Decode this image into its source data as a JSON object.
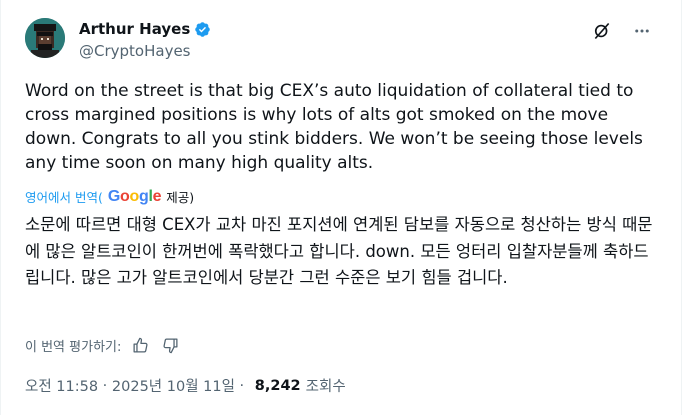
{
  "author": {
    "display_name": "Arthur Hayes",
    "handle": "@CryptoHayes",
    "verified_color": "#1d9bf0"
  },
  "tweet": {
    "text": "Word on the street is that big CEX’s auto liquidation of collateral tied to cross margined positions is why lots of alts got smoked on the move down. Congrats to all you stink bidders. We won’t be seeing those levels any time soon on many high quality alts."
  },
  "translation": {
    "label_prefix": "영어에서 번역(",
    "provider": "Google",
    "label_suffix": "제공)",
    "text": "소문에 따르면 대형 CEX가 교차 마진 포지션에 연계된 담보를 자동으로 청산하는 방식 때문에 많은 알트코인이 한꺼번에 폭락했다고 합니다. down. 모든 엉터리 입찰자분들께 축하드립니다. 많은 고가 알트코인에서 당분간 그런 수준은 보기 힘들 겁니다.",
    "rate_label": "이 번역 평가하기:"
  },
  "meta": {
    "time": "오전 11:58",
    "sep1": " · ",
    "date": "2025년 10월 11일",
    "sep2": " · ",
    "views": "8,242",
    "views_label": "조회수"
  },
  "icons": {
    "grok": "grok-icon",
    "more": "more-icon",
    "thumbs_up": "thumbs-up-icon",
    "thumbs_down": "thumbs-down-icon"
  },
  "colors": {
    "text": "#0f1419",
    "secondary": "#536471",
    "link": "#1d9bf0"
  }
}
